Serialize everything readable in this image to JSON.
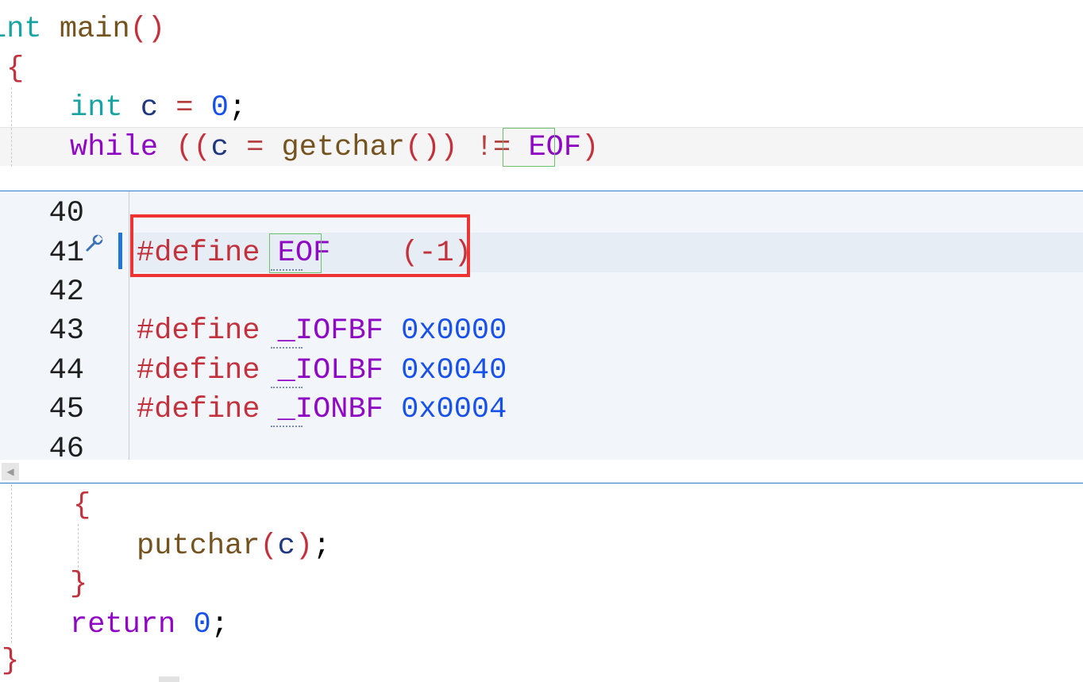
{
  "editor": {
    "code_top": {
      "line1": {
        "type": "int",
        "name": "main",
        "parens": "()"
      },
      "open_brace": "{",
      "line3": {
        "type": "int",
        "var": "c",
        "eq": "=",
        "num": "0",
        "semi": ";"
      },
      "line4": {
        "kw": "while",
        "p1": "((",
        "var": "c",
        "eq": "=",
        "fn": "getchar",
        "p2": "())",
        "neq": "!=",
        "macro": "EOF",
        "p3": ")"
      }
    },
    "code_bottom": {
      "inner_open": "{",
      "call": {
        "fn": "putchar",
        "open": "(",
        "arg": "c",
        "close": ")",
        "semi": ";"
      },
      "inner_close": "}",
      "ret": {
        "kw": "return",
        "num": "0",
        "semi": ";"
      },
      "close_brace": "}"
    }
  },
  "peek": {
    "line_numbers": [
      "40",
      "41",
      "42",
      "43",
      "44",
      "45",
      "46"
    ],
    "lines": {
      "l41": {
        "directive": "#define",
        "name": "EOF",
        "value": "(-1)"
      },
      "l43": {
        "directive": "#define",
        "name": "_IOFBF",
        "value": "0x0000"
      },
      "l44": {
        "directive": "#define",
        "name": "_IOLBF",
        "value": "0x0040"
      },
      "l45": {
        "directive": "#define",
        "name": "_IONBF",
        "value": "0x0004"
      }
    },
    "scroll_left_glyph": "◀"
  },
  "colors": {
    "highlight_box": "#ee3333",
    "peek_border": "#2e7ed0",
    "change_bar": "#1e78d4",
    "keyword_type": "#1aa3a3",
    "keyword": "#8f08c4",
    "preprocessor": "#c3323c",
    "number": "#1750eb"
  },
  "icons": {
    "quick_action": "wrench-icon"
  }
}
